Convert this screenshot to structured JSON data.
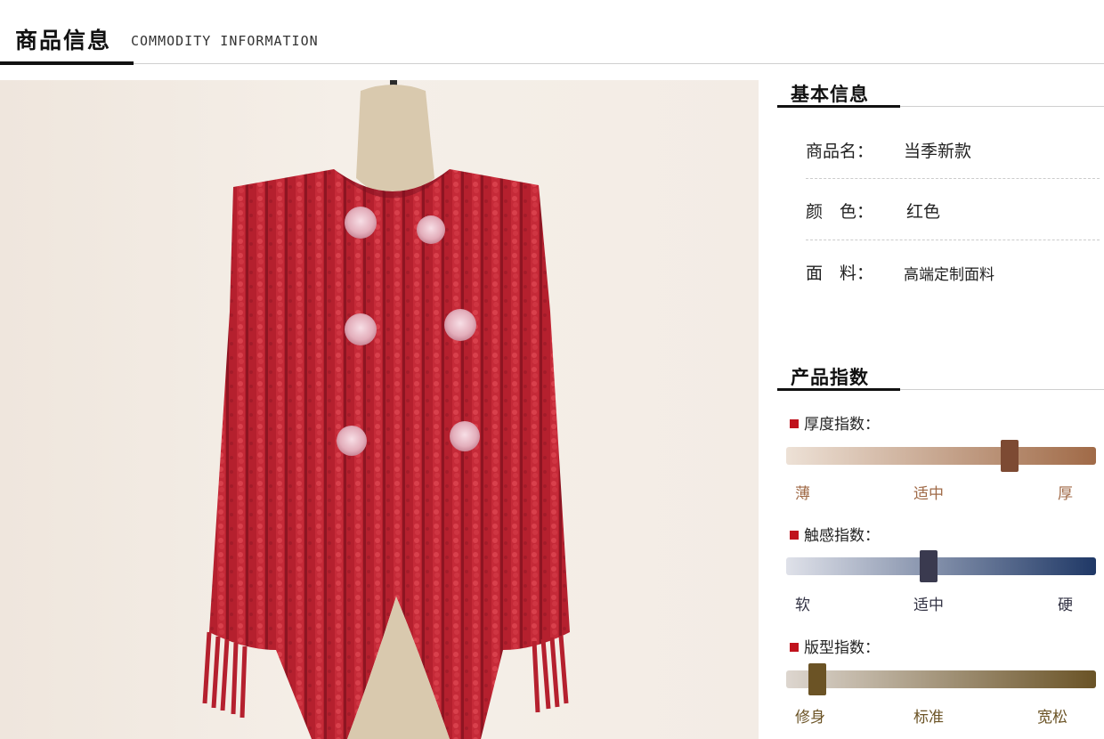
{
  "header": {
    "title": "商品信息",
    "subtitle": "COMMODITY INFORMATION"
  },
  "basic_info": {
    "section_title": "基本信息",
    "rows": [
      {
        "key": "商品名：",
        "value": "当季新款"
      },
      {
        "key": "颜　色：",
        "value": "红色"
      },
      {
        "key": "面　料：",
        "value": "高端定制面料"
      }
    ]
  },
  "product_index": {
    "section_title": "产品指数",
    "indices": [
      {
        "title": "厚度指数：",
        "labels": [
          "薄",
          "适中",
          "厚"
        ],
        "level": 0.72,
        "bar_color_start": "#ede1d6",
        "bar_color_end": "#a06a47",
        "knob_color": "#7d4a33",
        "label_color": "#a06a47"
      },
      {
        "title": "触感指数：",
        "labels": [
          "软",
          "适中",
          "硬"
        ],
        "level": 0.46,
        "bar_color_start": "#dfe1e9",
        "bar_color_end": "#1f3866",
        "knob_color": "#3a3a4f",
        "label_color": "#333344"
      },
      {
        "title": "版型指数：",
        "labels": [
          "修身",
          "标准",
          "宽松"
        ],
        "level": 0.1,
        "bar_color_start": "#ddd6cf",
        "bar_color_end": "#6a5326",
        "knob_color": "#6b5325",
        "label_color": "#6b5325"
      }
    ]
  },
  "colors": {
    "accent_red": "#c0121c",
    "jacket_red": "#b5202e"
  }
}
